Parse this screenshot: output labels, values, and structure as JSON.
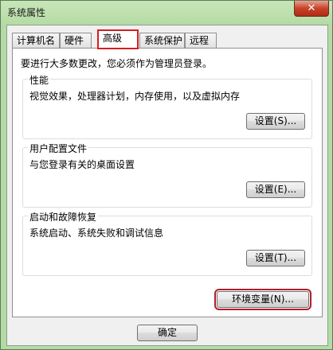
{
  "window": {
    "title": "系统属性",
    "close_label": "✕"
  },
  "tabs": [
    {
      "label": "计算机名"
    },
    {
      "label": "硬件"
    },
    {
      "label": "高级"
    },
    {
      "label": "系统保护"
    },
    {
      "label": "远程"
    }
  ],
  "admin_note": "要进行大多数更改，您必须作为管理员登录。",
  "performance": {
    "title": "性能",
    "description": "视觉效果，处理器计划，内存使用，以及虚拟内存",
    "button": "设置(S)..."
  },
  "user_profiles": {
    "title": "用户配置文件",
    "description": "与您登录有关的桌面设置",
    "button": "设置(E)..."
  },
  "startup_recovery": {
    "title": "启动和故障恢复",
    "description": "系统启动、系统失败和调试信息",
    "button": "设置(T)..."
  },
  "env_button": "环境变量(N)...",
  "ok_button": "确定",
  "colors": {
    "highlight": "#d81e1e",
    "window_frame": "#b5dba5",
    "close": "#c7432b"
  }
}
